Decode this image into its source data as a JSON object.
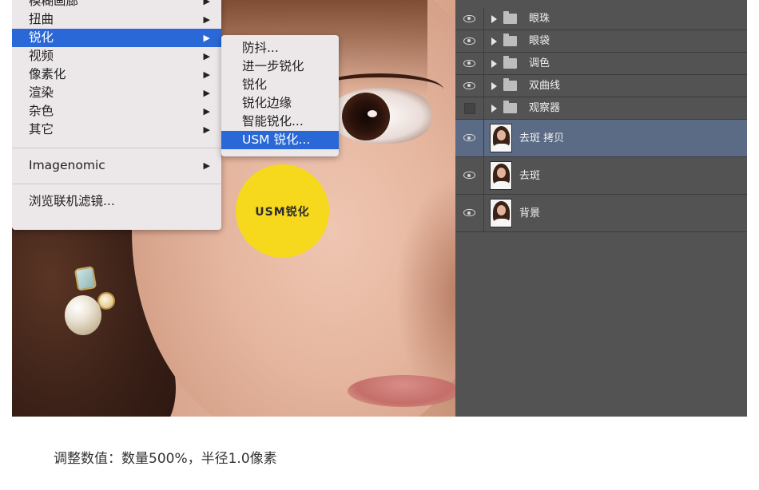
{
  "filter_menu": {
    "items": [
      {
        "label": "模糊画廊",
        "submenu": true
      },
      {
        "label": "扭曲",
        "submenu": true
      },
      {
        "label": "锐化",
        "submenu": true,
        "active": true
      },
      {
        "label": "视频",
        "submenu": true
      },
      {
        "label": "像素化",
        "submenu": true
      },
      {
        "label": "渲染",
        "submenu": true
      },
      {
        "label": "杂色",
        "submenu": true
      },
      {
        "label": "其它",
        "submenu": true
      },
      {
        "label": "Imagenomic",
        "submenu": true
      },
      {
        "label": "浏览联机滤镜...",
        "submenu": false
      }
    ],
    "arrow_glyph": "▶"
  },
  "sharpen_submenu": {
    "items": [
      {
        "label": "防抖..."
      },
      {
        "label": "进一步锐化"
      },
      {
        "label": "锐化"
      },
      {
        "label": "锐化边缘"
      },
      {
        "label": "智能锐化..."
      },
      {
        "label": "USM 锐化...",
        "active": true
      }
    ]
  },
  "highlight_badge": {
    "label": "USM锐化",
    "color": "#f6d81c"
  },
  "layers_panel": {
    "groups": [
      {
        "name": "眼珠",
        "visible": true
      },
      {
        "name": "眼袋",
        "visible": true
      },
      {
        "name": "调色",
        "visible": true
      },
      {
        "name": "双曲线",
        "visible": true
      },
      {
        "name": "观察器",
        "visible": false
      }
    ],
    "layers": [
      {
        "name": "去斑 拷贝",
        "visible": true,
        "selected": true
      },
      {
        "name": "去斑",
        "visible": true,
        "selected": false
      },
      {
        "name": "背景",
        "visible": true,
        "selected": false
      }
    ]
  },
  "caption": "调整数值：数量500%，半径1.0像素",
  "colors": {
    "menu_highlight": "#2968d6",
    "panel_bg": "#535353",
    "selected_layer": "#5b6b85"
  }
}
